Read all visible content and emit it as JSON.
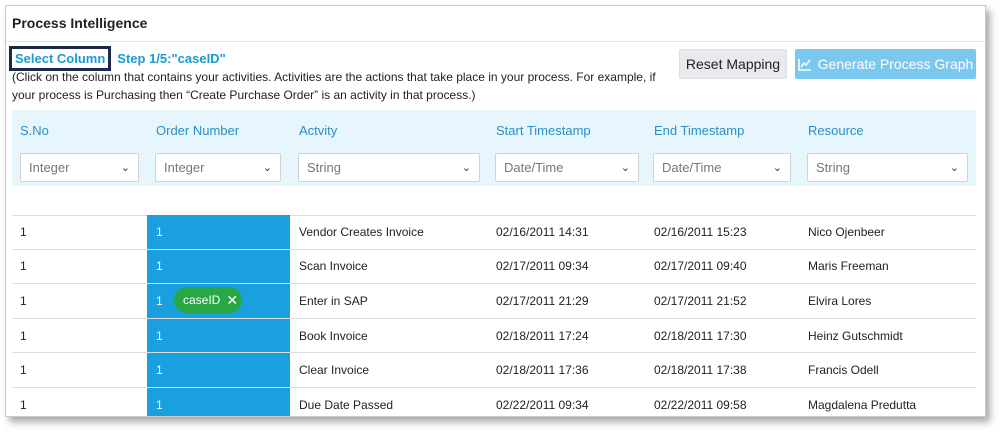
{
  "header": {
    "title": "Process Intelligence"
  },
  "step": {
    "select_label": "Select Column",
    "step_label": "Step 1/5:\"caseID\""
  },
  "help_text": "(Click on the column that contains your activities. Activities are the actions that take place in your process. For example, if your process is Purchasing then “Create Purchase Order” is an activity in that process.)",
  "buttons": {
    "reset": "Reset Mapping",
    "generate": "Generate Process Graph",
    "generate_icon": "chart-line-icon"
  },
  "columns": [
    {
      "title": "S.No",
      "type": "Integer"
    },
    {
      "title": "Order Number",
      "type": "Integer"
    },
    {
      "title": "Actvity",
      "type": "String"
    },
    {
      "title": "Start Timestamp",
      "type": "Date/Time"
    },
    {
      "title": "End Timestamp",
      "type": "Date/Time"
    },
    {
      "title": "Resource",
      "type": "String"
    }
  ],
  "rows": [
    [
      "1",
      "1",
      "Vendor Creates Invoice",
      "02/16/2011 14:31",
      "02/16/2011 15:23",
      "Nico Ojenbeer"
    ],
    [
      "1",
      "1",
      "Scan Invoice",
      "02/17/2011 09:34",
      "02/17/2011 09:40",
      "Maris Freeman"
    ],
    [
      "1",
      "1",
      "Enter in SAP",
      "02/17/2011 21:29",
      "02/17/2011 21:52",
      "Elvira Lores"
    ],
    [
      "1",
      "1",
      "Book Invoice",
      "02/18/2011 17:24",
      "02/18/2011 17:30",
      "Heinz Gutschmidt"
    ],
    [
      "1",
      "1",
      "Clear Invoice",
      "02/18/2011 17:36",
      "02/18/2011 17:38",
      "Francis Odell"
    ],
    [
      "1",
      "1",
      "Due Date Passed",
      "02/22/2011 09:34",
      "02/22/2011 09:58",
      "Magdalena Predutta"
    ]
  ],
  "tag": {
    "label": "caseID",
    "close_icon": "close-icon"
  },
  "colors": {
    "accent": "#1a9ad6",
    "highlight": "#1aa0de",
    "tag": "#28a745",
    "header_bg": "#e6f6fc"
  }
}
